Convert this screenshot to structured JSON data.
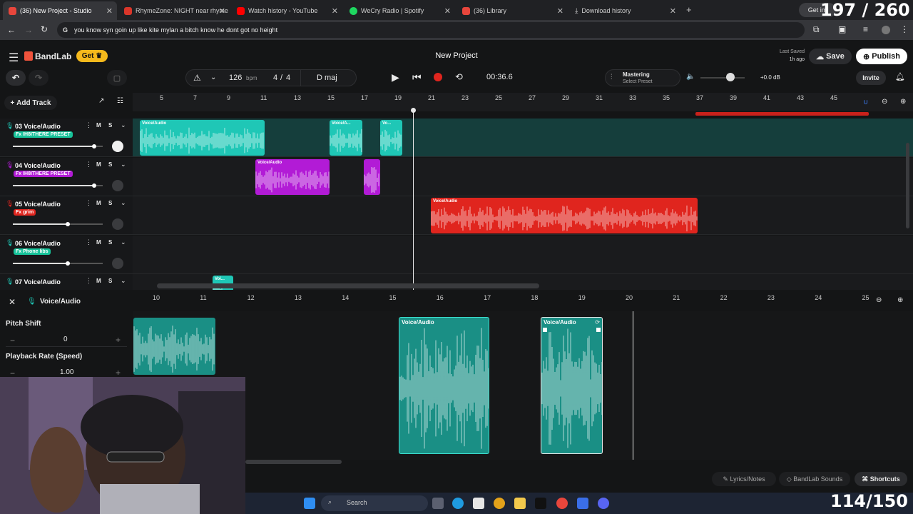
{
  "browser": {
    "tabs": [
      {
        "title": "(36) New Project - Studio",
        "color": "#e8463c",
        "active": true
      },
      {
        "title": "RhymeZone: NIGHT near rhyme",
        "color": "#d9362a",
        "active": false
      },
      {
        "title": "Watch history - YouTube",
        "color": "#ff0000",
        "active": false
      },
      {
        "title": "WeCry Radio | Spotify",
        "color": "#1ed760",
        "active": false
      },
      {
        "title": "(36) Library",
        "color": "#e8463c",
        "active": false
      },
      {
        "title": "Download history",
        "color": "#cccccc",
        "active": false
      }
    ],
    "address": "you know syn goin up like kite mylan a bitch know he dont got no height"
  },
  "overlay": {
    "top_counter": "197 / 260",
    "bottom_counter": "114/150",
    "get_button": "Get im"
  },
  "app": {
    "brand": "BandLab",
    "get_label": "Get",
    "project_title": "New Project",
    "last_saved_label": "Last Saved",
    "last_saved_time": "1h ago",
    "save_label": "Save",
    "publish_label": "Publish",
    "tempo": "126",
    "tempo_unit": "bpm",
    "time_sig_num": "4",
    "time_sig_den": "4",
    "key": "D maj",
    "time": "00:36.6",
    "mastering_title": "Mastering",
    "mastering_sub": "Select Preset",
    "volume_db": "+0.0 dB",
    "invite_label": "Invite",
    "add_track_label": "Add Track",
    "accent": "#f5b91c"
  },
  "ruler_top": [
    "5",
    "7",
    "9",
    "11",
    "13",
    "15",
    "17",
    "19",
    "21",
    "23",
    "25",
    "27",
    "29",
    "31",
    "33",
    "35",
    "37",
    "39",
    "41",
    "43",
    "45"
  ],
  "tracks": [
    {
      "name": "03  Voice/Audio",
      "fx": "Fx IH8ITHERE PRESET",
      "fx_color": "#17c39a",
      "color": "#1fc7b6",
      "vol": 0.9
    },
    {
      "name": "04  Voice/Audio",
      "fx": "Fx IH8ITHERE PRESET",
      "fx_color": "#b21bd6",
      "color": "#b21bd6",
      "vol": 0.9
    },
    {
      "name": "05  Voice/Audio",
      "fx": "Fx grim",
      "fx_color": "#e0251e",
      "color": "#e0251e",
      "vol": 0.6
    },
    {
      "name": "06  Voice/Audio",
      "fx": "Fx Phone libs",
      "fx_color": "#17c39a",
      "color": "#1fc7b6",
      "vol": 0.6
    },
    {
      "name": "07  Voice/Audio",
      "fx": "",
      "fx_color": "#17c39a",
      "color": "#1fc7b6",
      "vol": 0.6
    }
  ],
  "mute_label": "M",
  "solo_label": "S",
  "clip_label": "Voice/Audio",
  "clip_short": "Voice/A...",
  "clip_tiny": "Vo...",
  "clip_tiny2": "Voi...",
  "editor": {
    "title": "Voice/Audio",
    "pitch_label": "Pitch Shift",
    "pitch_value": "0",
    "rate_label": "Playback Rate (Speed)",
    "rate_value": "1.00",
    "ruler": [
      "10",
      "11",
      "12",
      "13",
      "14",
      "15",
      "16",
      "17",
      "18",
      "19",
      "20",
      "21",
      "22",
      "23",
      "24",
      "25"
    ]
  },
  "footer": {
    "lyrics": "Lyrics/Notes",
    "sounds": "BandLab Sounds",
    "shortcuts": "Shortcuts"
  },
  "taskbar": {
    "search": "Search"
  }
}
